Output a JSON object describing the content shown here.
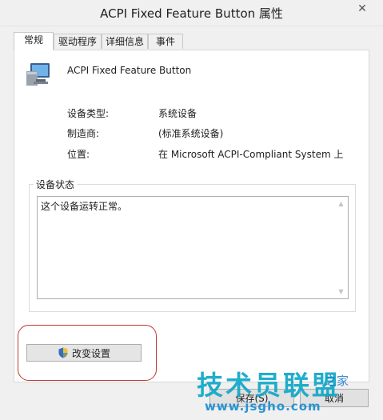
{
  "window": {
    "title": "ACPI Fixed Feature Button 属性",
    "close_glyph": "✕"
  },
  "tabs": [
    {
      "label": "常规",
      "active": true
    },
    {
      "label": "驱动程序",
      "active": false
    },
    {
      "label": "详细信息",
      "active": false
    },
    {
      "label": "事件",
      "active": false
    }
  ],
  "device": {
    "icon": "monitor-device-icon",
    "name": "ACPI Fixed Feature Button",
    "properties": [
      {
        "label": "设备类型:",
        "value": "系统设备"
      },
      {
        "label": "制造商:",
        "value": "(标准系统设备)"
      },
      {
        "label": "位置:",
        "value": "在 Microsoft ACPI-Compliant System 上"
      }
    ]
  },
  "status": {
    "group_label": "设备状态",
    "text": "这个设备运转正常。"
  },
  "change_settings": {
    "label": "改变设置",
    "icon": "uac-shield-icon"
  },
  "footer": {
    "ok_label": "保存(S)",
    "cancel_label": "取消"
  },
  "watermark": {
    "main": "技术员联盟",
    "tail": "之家",
    "url": "www.jsgho.com"
  },
  "colors": {
    "highlight": "#c0392b",
    "watermark": "#0fa8c8",
    "button_face": "#e5e5e5"
  }
}
